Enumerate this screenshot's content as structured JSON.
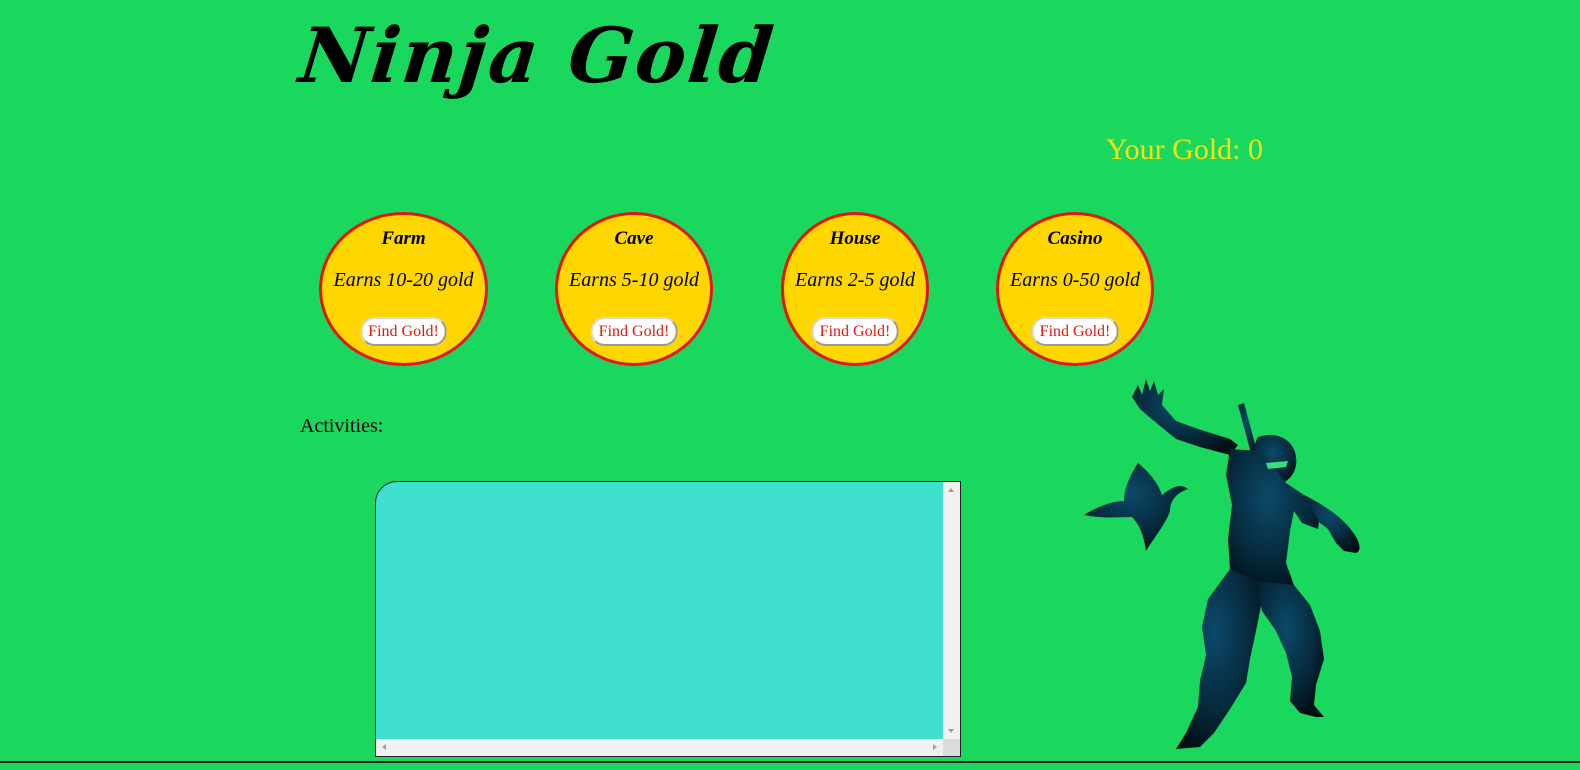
{
  "header": {
    "title": "Ninja Gold"
  },
  "gold": {
    "label": "Your Gold: 0"
  },
  "locations": [
    {
      "name": "Farm",
      "earns": "Earns 10-20 gold",
      "button": "Find Gold!"
    },
    {
      "name": "Cave",
      "earns": "Earns 5-10 gold",
      "button": "Find Gold!"
    },
    {
      "name": "House",
      "earns": "Earns 2-5 gold",
      "button": "Find Gold!"
    },
    {
      "name": "Casino",
      "earns": "Earns 0-50 gold",
      "button": "Find Gold!"
    }
  ],
  "activities": {
    "label": "Activities:",
    "log": ""
  },
  "colors": {
    "background": "#19d85d",
    "gold_text": "#f2e318",
    "circle_fill": "#ffd700",
    "circle_border": "#e0180e",
    "activity_box": "#40e0d0",
    "ninja": "#06202e"
  },
  "icons": {
    "ninja_illustration": "ninja-with-shuriken-icon"
  }
}
